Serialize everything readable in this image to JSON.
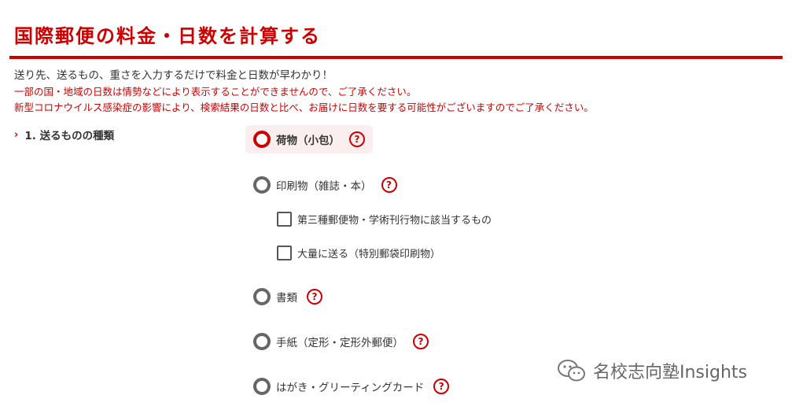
{
  "page": {
    "title": "国際郵便の料金・日数を計算する",
    "intro": "送り先、送るもの、重さを入力するだけで料金と日数が早わかり！",
    "notices": [
      "一部の国・地域の日数は情勢などにより表示することができませんので、ご了承ください。",
      "新型コロナウイルス感染症の影響により、検索結果の日数と比べ、お届けに日数を要する可能性がございますのでご了承ください。"
    ],
    "accent_color": "#cc0000"
  },
  "section": {
    "chevron": "›",
    "heading": "1. 送るものの種類"
  },
  "options": [
    {
      "label": "荷物（小包）",
      "selected": true
    },
    {
      "label": "印刷物（雑誌・本）",
      "selected": false
    },
    {
      "label": "書類",
      "selected": false
    },
    {
      "label": "手紙（定形・定形外郵便）",
      "selected": false
    },
    {
      "label": "はがき・グリーティングカード",
      "selected": false
    }
  ],
  "printed_matter_checkboxes": [
    {
      "label": "第三種郵便物・学術刊行物に該当するもの",
      "checked": false
    },
    {
      "label": "大量に送る（特別郵袋印刷物）",
      "checked": false
    }
  ],
  "help_icon_text": "?",
  "watermark": {
    "icon": "wechat-icon",
    "text": "名校志向塾Insights"
  }
}
